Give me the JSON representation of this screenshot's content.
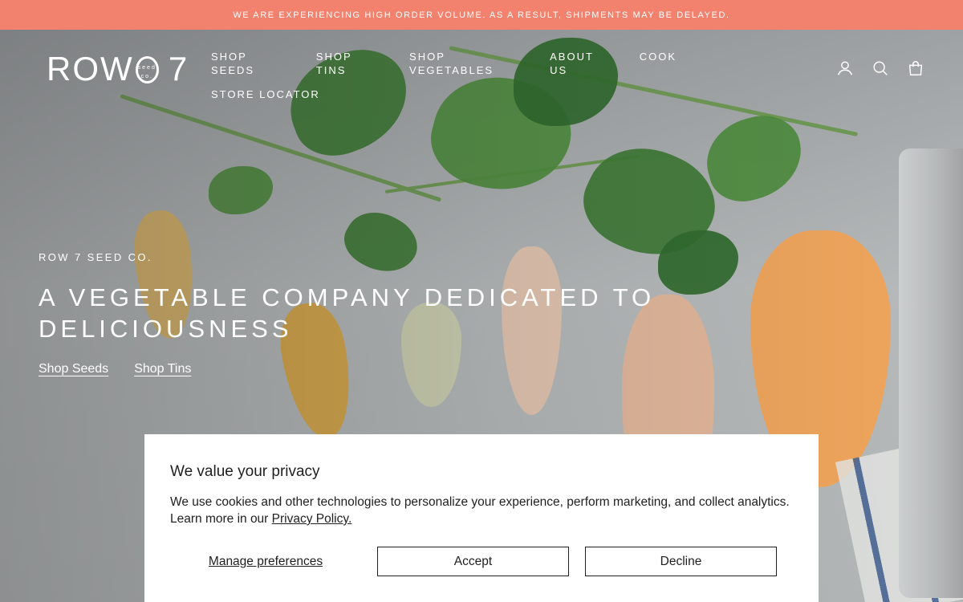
{
  "announcement": "WE ARE EXPERIENCING HIGH ORDER VOLUME. AS A RESULT, SHIPMENTS MAY BE DELAYED.",
  "logo": {
    "text_left": "ROW",
    "text_right": "7",
    "badge": "seed co."
  },
  "nav": {
    "row1": [
      "SHOP SEEDS",
      "SHOP TINS",
      "SHOP VEGETABLES",
      "ABOUT US",
      "COOK"
    ],
    "row2": [
      "STORE LOCATOR"
    ]
  },
  "header_icons": [
    "account-icon",
    "search-icon",
    "cart-icon"
  ],
  "hero": {
    "eyebrow": "ROW 7 SEED CO.",
    "headline": "A VEGETABLE COMPANY DEDICATED TO DELICIOUSNESS",
    "links": [
      "Shop Seeds",
      "Shop Tins"
    ]
  },
  "cookie": {
    "title": "We value your privacy",
    "body": "We use cookies and other technologies to personalize your experience, perform marketing, and collect analytics. Learn more in our ",
    "policy_link": "Privacy Policy.",
    "manage": "Manage preferences",
    "accept": "Accept",
    "decline": "Decline"
  },
  "colors": {
    "announcement_bg": "#f2826d",
    "text_on_hero": "#ffffff",
    "banner_bg": "#ffffff"
  }
}
